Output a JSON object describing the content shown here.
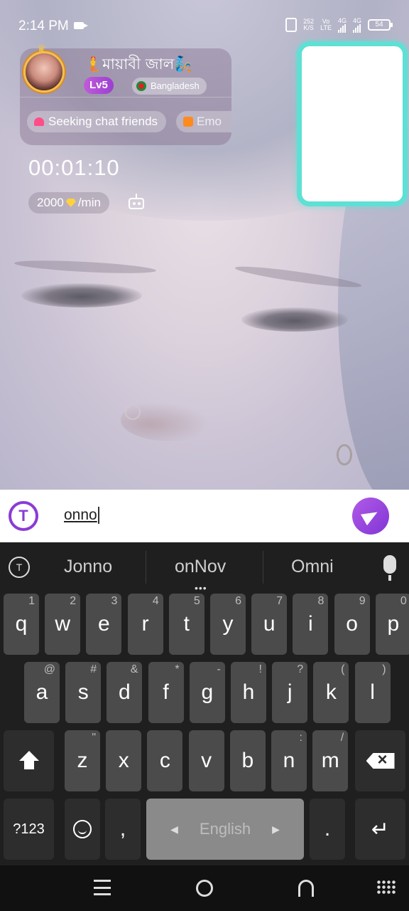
{
  "status_bar": {
    "time": "2:14 PM",
    "net_speed_value": "252",
    "net_speed_unit": "K/S",
    "volte_top": "Vo",
    "volte_bottom": "LTE",
    "sig1_label": "4G",
    "sig2_label": "4G",
    "battery": "54"
  },
  "profile": {
    "username": "🧜মায়াবী জাল🧞",
    "level": "Lv5",
    "country": "Bangladesh",
    "tag1": "Seeking chat friends",
    "tag2": "Emo"
  },
  "call": {
    "timer": "00:01:10",
    "rate_value": "2000",
    "rate_unit": "/min"
  },
  "input": {
    "text": "onno"
  },
  "keyboard": {
    "suggestions": [
      "Jonno",
      "onNov",
      "Omni"
    ],
    "row1": [
      {
        "k": "q",
        "h": "1"
      },
      {
        "k": "w",
        "h": "2"
      },
      {
        "k": "e",
        "h": "3"
      },
      {
        "k": "r",
        "h": "4"
      },
      {
        "k": "t",
        "h": "5"
      },
      {
        "k": "y",
        "h": "6"
      },
      {
        "k": "u",
        "h": "7"
      },
      {
        "k": "i",
        "h": "8"
      },
      {
        "k": "o",
        "h": "9"
      },
      {
        "k": "p",
        "h": "0"
      }
    ],
    "row2": [
      {
        "k": "a",
        "h": "@"
      },
      {
        "k": "s",
        "h": "#"
      },
      {
        "k": "d",
        "h": "&"
      },
      {
        "k": "f",
        "h": "*"
      },
      {
        "k": "g",
        "h": "-"
      },
      {
        "k": "h",
        "h": "!"
      },
      {
        "k": "j",
        "h": "?"
      },
      {
        "k": "k",
        "h": "("
      },
      {
        "k": "l",
        "h": ")"
      }
    ],
    "row3": [
      {
        "k": "z",
        "h": "\""
      },
      {
        "k": "x",
        "h": ""
      },
      {
        "k": "c",
        "h": ""
      },
      {
        "k": "v",
        "h": ""
      },
      {
        "k": "b",
        "h": ""
      },
      {
        "k": "n",
        "h": ":"
      },
      {
        "k": "m",
        "h": "/"
      }
    ],
    "sym_key": "?123",
    "comma": ",",
    "space_label": "English",
    "period": ".",
    "enter": "↵"
  },
  "colors": {
    "accent": "#8a3cd6",
    "selfview_border": "#5fe0d4",
    "key_bg": "#4b4b4b",
    "keyboard_bg": "#1f1f1f"
  }
}
